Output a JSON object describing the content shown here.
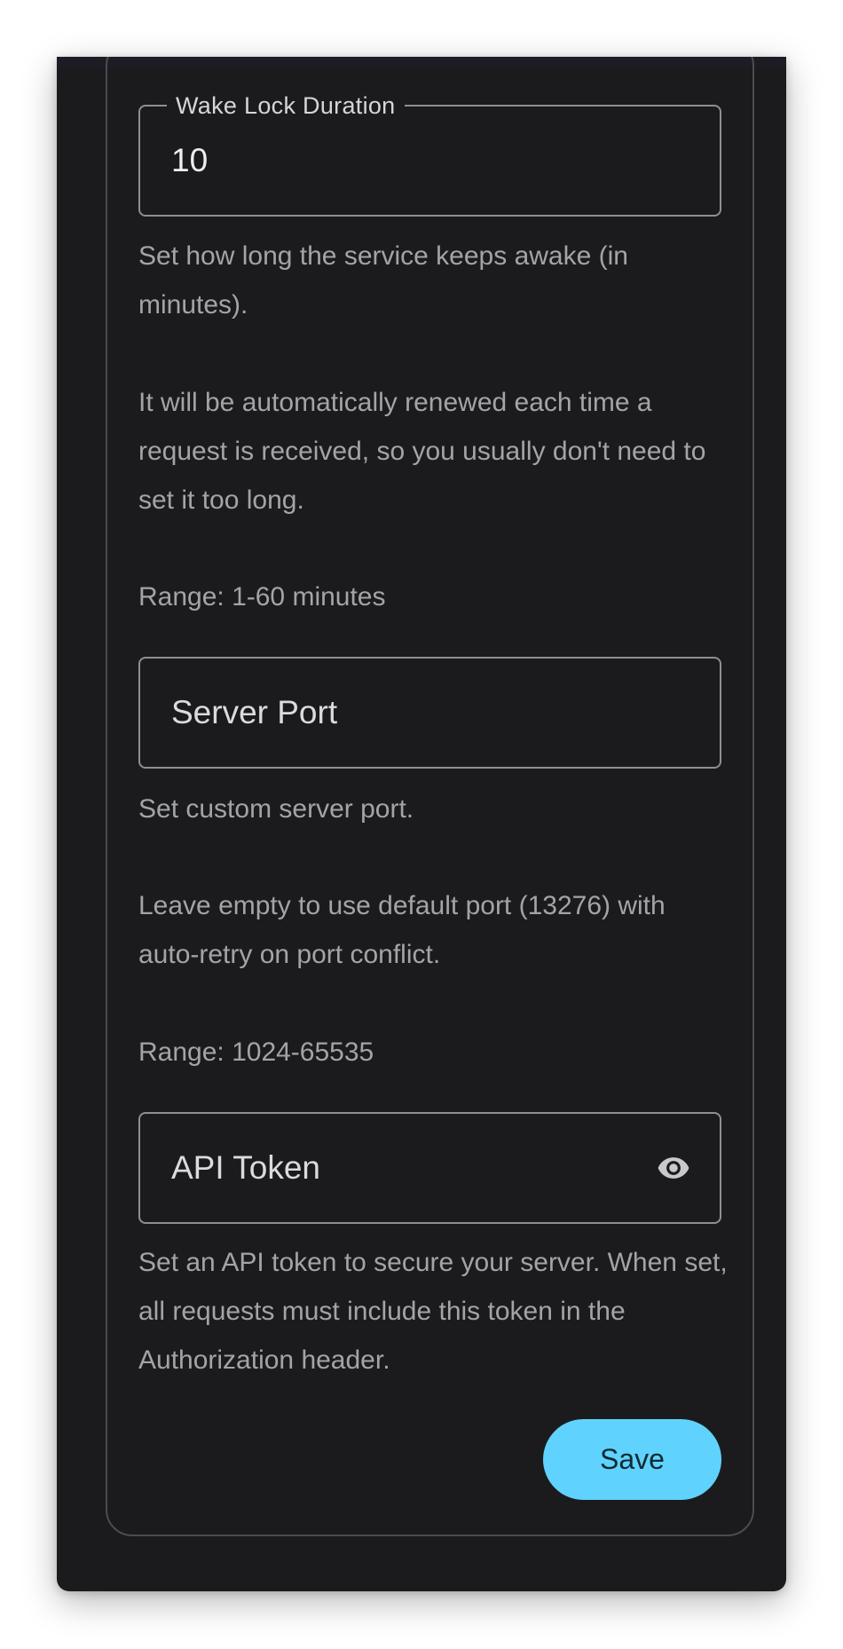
{
  "settings": {
    "wake_lock": {
      "label": "Wake Lock Duration",
      "value": "10",
      "help_1": "Set how long the service keeps awake (in minutes).",
      "help_2": "It will be automatically renewed each time a request is received, so you usually don't need to set it too long.",
      "help_3": "Range: 1-60 minutes"
    },
    "server_port": {
      "placeholder": "Server Port",
      "help_1": "Set custom server port.",
      "help_2": "Leave empty to use default port (13276) with auto-retry on port conflict.",
      "help_3": "Range: 1024-65535"
    },
    "api_token": {
      "placeholder": "API Token",
      "visibility_icon": "eye-icon",
      "help_1": "Set an API token to secure your server. When set, all requests must include this token in the Authorization header."
    },
    "save_label": "Save"
  },
  "colors": {
    "background": "#1b1b1d",
    "accent": "#5fd3fd",
    "help_text": "#a2a4a7",
    "field_border": "#8d8f93"
  }
}
